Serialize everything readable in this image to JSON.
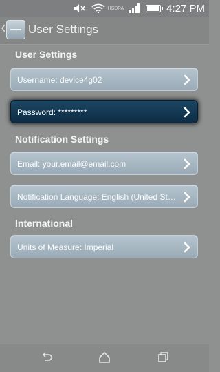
{
  "status_bar": {
    "network_label": "HSDPA",
    "battery_label": "",
    "time": "4:27",
    "time_suffix": "PM"
  },
  "action_bar": {
    "title": "User Settings"
  },
  "sections": [
    {
      "header": "User Settings",
      "items": [
        {
          "label": "Username: device4g02",
          "selected": false
        },
        {
          "label": "Password: *********",
          "selected": true
        }
      ]
    },
    {
      "header": "Notification Settings",
      "items": [
        {
          "label": "Email: your.email@email.com",
          "selected": false
        },
        {
          "label": "Notification Language: English (United States)",
          "selected": false
        }
      ]
    },
    {
      "header": "International",
      "items": [
        {
          "label": "Units of Measure: Imperial",
          "selected": false
        }
      ]
    }
  ],
  "nav": {
    "back": "back-icon",
    "home": "home-icon",
    "recents": "recents-icon"
  },
  "colors": {
    "selected_row": "#0f2e47",
    "row": "#a8b7c2",
    "background": "#8f9090"
  }
}
